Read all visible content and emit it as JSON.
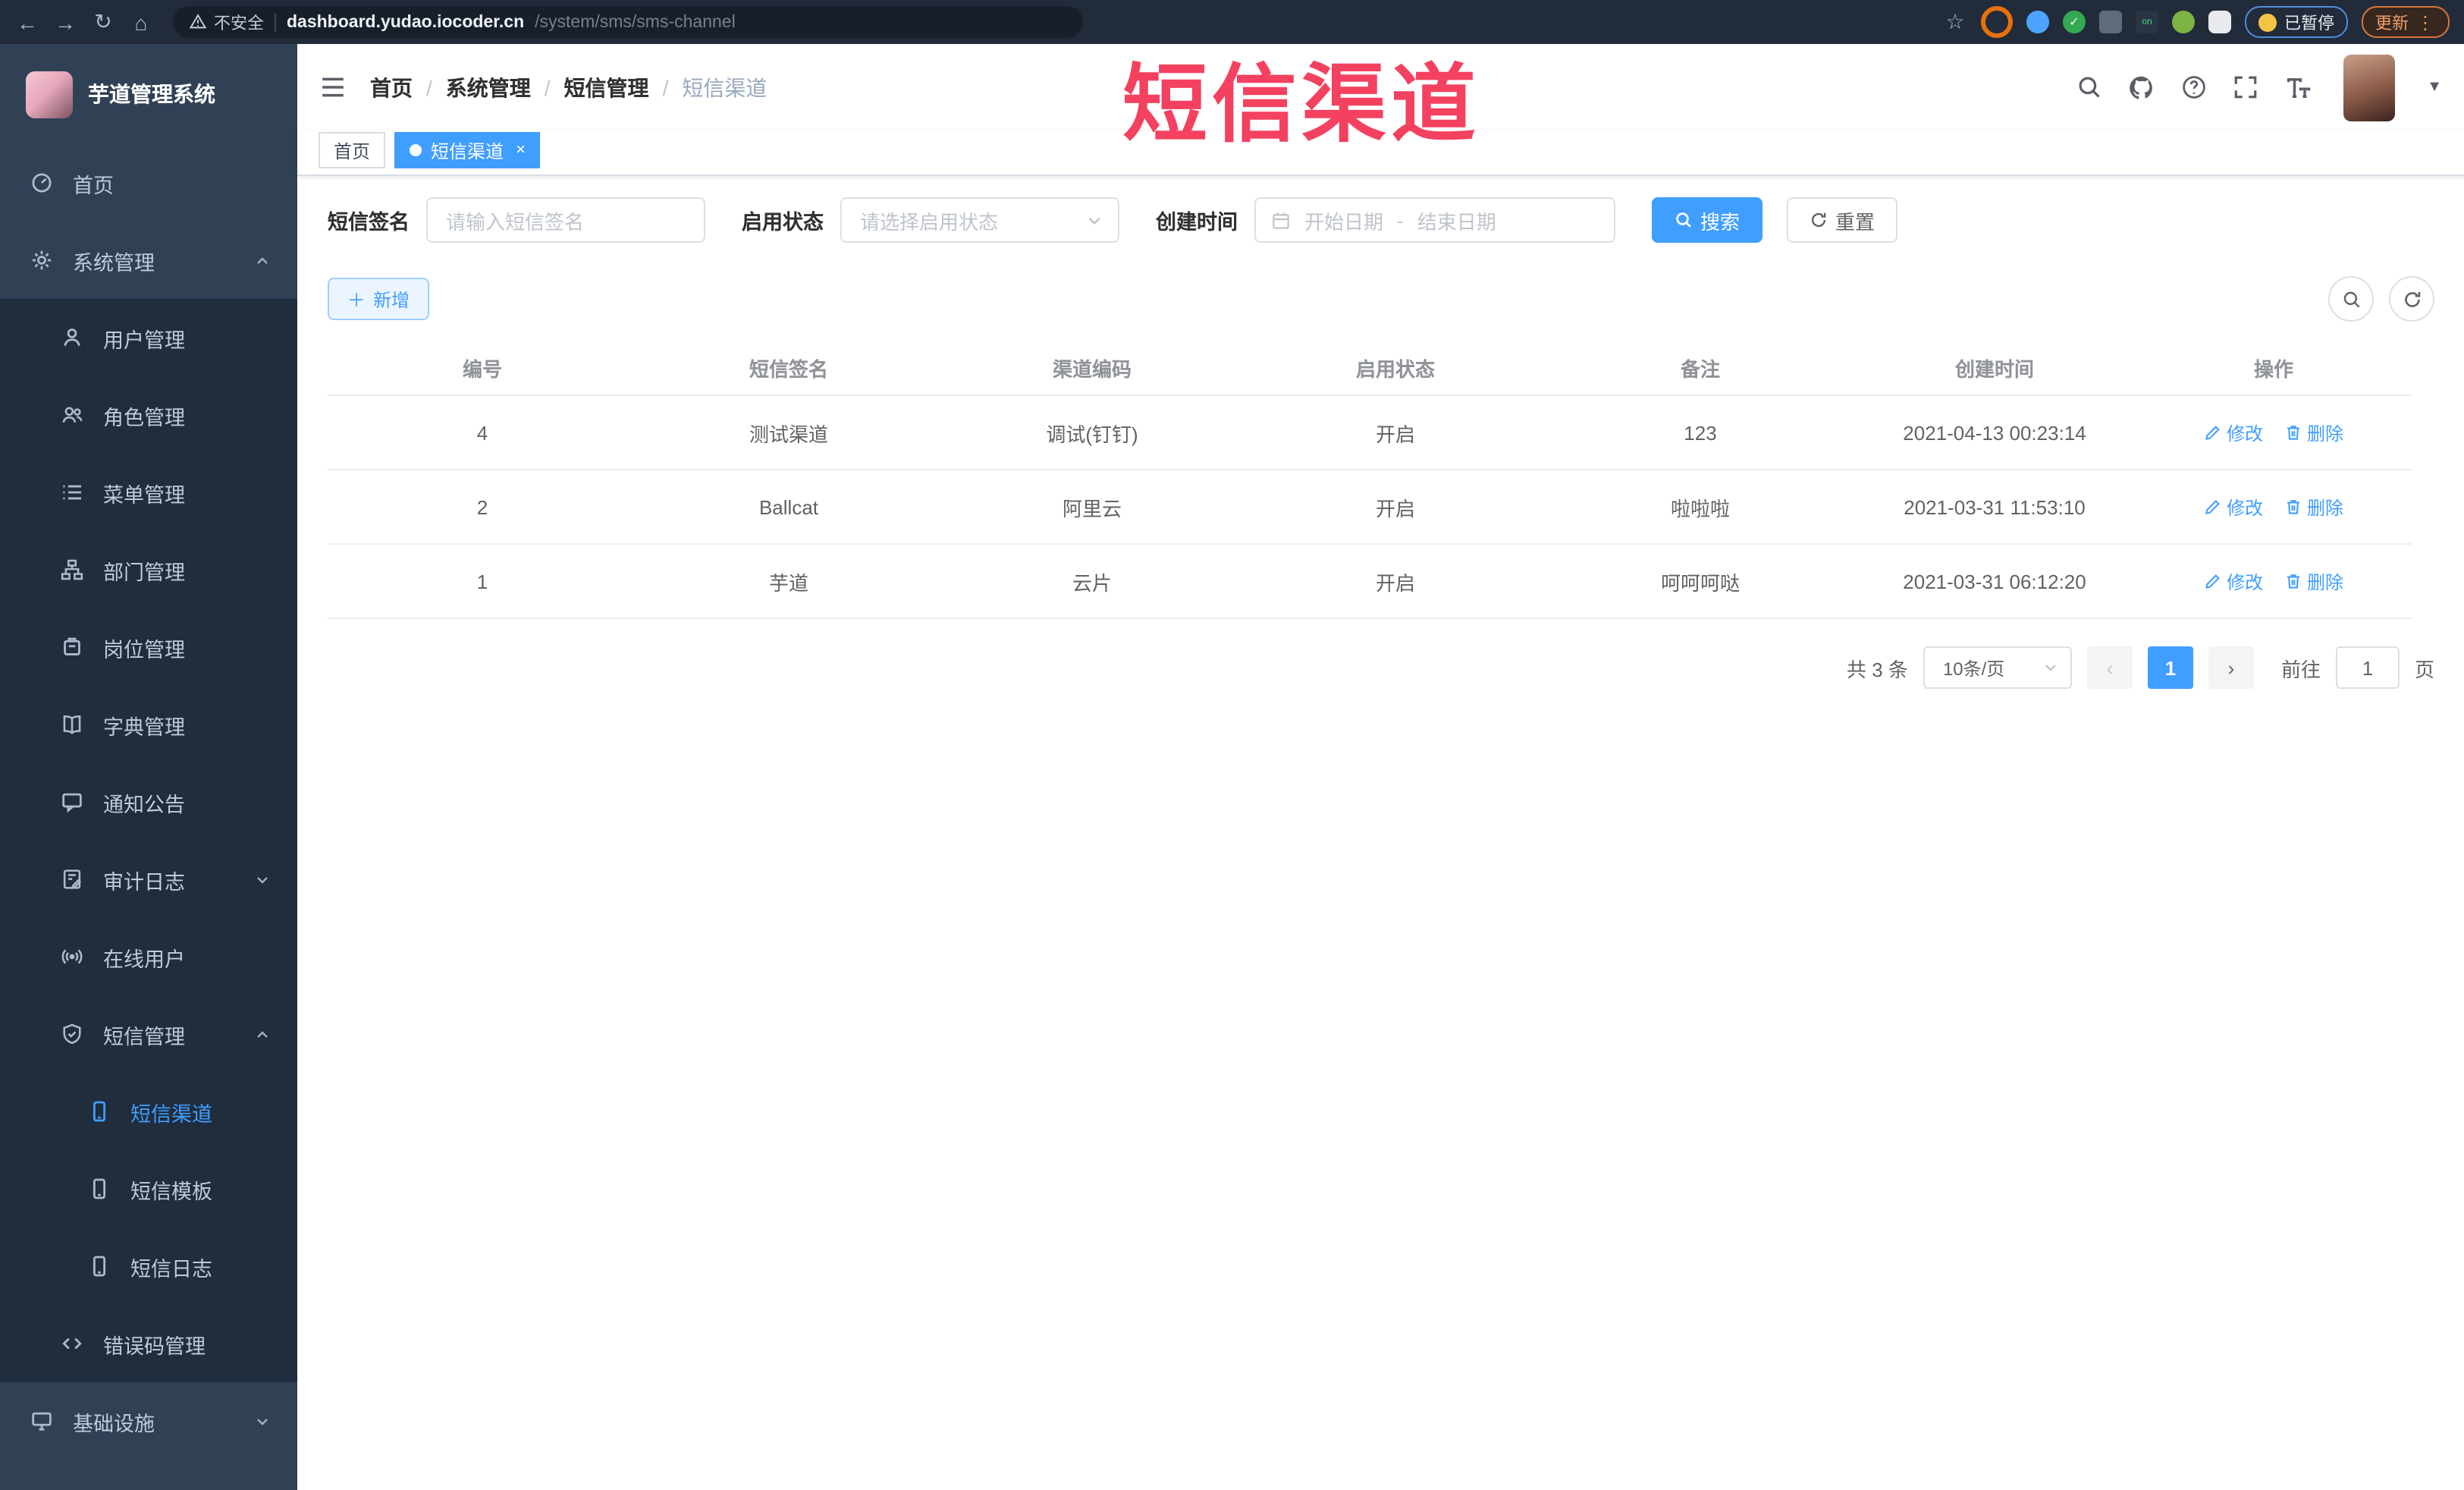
{
  "colors": {
    "primary": "#409EFF",
    "sidebar_bg": "#304156",
    "submenu_bg": "#1f2d3d",
    "annotation": "#f4415f",
    "active_tab": "#409EFF"
  },
  "browser": {
    "security_label": "不安全",
    "url_domain": "dashboard.yudao.iocoder.cn",
    "url_path": "/system/sms/sms-channel",
    "paused_badge": "已暂停",
    "update_button": "更新"
  },
  "annotation": {
    "text": "短信渠道"
  },
  "sidebar": {
    "logo_title": "芋道管理系统",
    "items": [
      {
        "label": "首页",
        "icon": "dashboard-icon",
        "depth": 0
      },
      {
        "label": "系统管理",
        "icon": "gear-icon",
        "depth": 0,
        "arrow": "up"
      },
      {
        "label": "用户管理",
        "icon": "user-icon",
        "depth": 1
      },
      {
        "label": "角色管理",
        "icon": "roles-icon",
        "depth": 1
      },
      {
        "label": "菜单管理",
        "icon": "menu-list-icon",
        "depth": 1
      },
      {
        "label": "部门管理",
        "icon": "org-tree-icon",
        "depth": 1
      },
      {
        "label": "岗位管理",
        "icon": "post-badge-icon",
        "depth": 1
      },
      {
        "label": "字典管理",
        "icon": "dictionary-icon",
        "depth": 1
      },
      {
        "label": "通知公告",
        "icon": "notice-icon",
        "depth": 1
      },
      {
        "label": "审计日志",
        "icon": "audit-log-icon",
        "depth": 1,
        "arrow": "down"
      },
      {
        "label": "在线用户",
        "icon": "online-users-icon",
        "depth": 1
      },
      {
        "label": "短信管理",
        "icon": "sms-shield-icon",
        "depth": 1,
        "arrow": "up"
      },
      {
        "label": "短信渠道",
        "icon": "phone-icon",
        "depth": 2,
        "active": true
      },
      {
        "label": "短信模板",
        "icon": "phone-icon",
        "depth": 2
      },
      {
        "label": "短信日志",
        "icon": "phone-icon",
        "depth": 2
      },
      {
        "label": "错误码管理",
        "icon": "code-icon",
        "depth": 1
      },
      {
        "label": "基础设施",
        "icon": "monitor-icon",
        "depth": 0,
        "arrow": "down"
      }
    ]
  },
  "breadcrumb": {
    "items": [
      "首页",
      "系统管理",
      "短信管理",
      "短信渠道"
    ]
  },
  "tabs": [
    {
      "label": "首页",
      "active": false
    },
    {
      "label": "短信渠道",
      "active": true
    }
  ],
  "filters": {
    "sign_label": "短信签名",
    "sign_placeholder": "请输入短信签名",
    "status_label": "启用状态",
    "status_placeholder": "请选择启用状态",
    "time_label": "创建时间",
    "start_placeholder": "开始日期",
    "range_separator": "-",
    "end_placeholder": "结束日期",
    "search_label": "搜索",
    "reset_label": "重置"
  },
  "toolbar": {
    "add_label": "新增"
  },
  "table": {
    "columns": [
      "编号",
      "短信签名",
      "渠道编码",
      "启用状态",
      "备注",
      "创建时间",
      "操作"
    ],
    "rows": [
      {
        "id": "4",
        "sign": "测试渠道",
        "code": "调试(钉钉)",
        "status": "开启",
        "remark": "123",
        "created": "2021-04-13 00:23:14"
      },
      {
        "id": "2",
        "sign": "Ballcat",
        "code": "阿里云",
        "status": "开启",
        "remark": "啦啦啦",
        "created": "2021-03-31 11:53:10"
      },
      {
        "id": "1",
        "sign": "芋道",
        "code": "云片",
        "status": "开启",
        "remark": "呵呵呵哒",
        "created": "2021-03-31 06:12:20"
      }
    ],
    "edit_label": "修改",
    "delete_label": "删除"
  },
  "pagination": {
    "total_text": "共 3 条",
    "page_size": "10条/页",
    "current_page": "1",
    "goto_label": "前往",
    "goto_value": "1",
    "page_suffix": "页"
  }
}
